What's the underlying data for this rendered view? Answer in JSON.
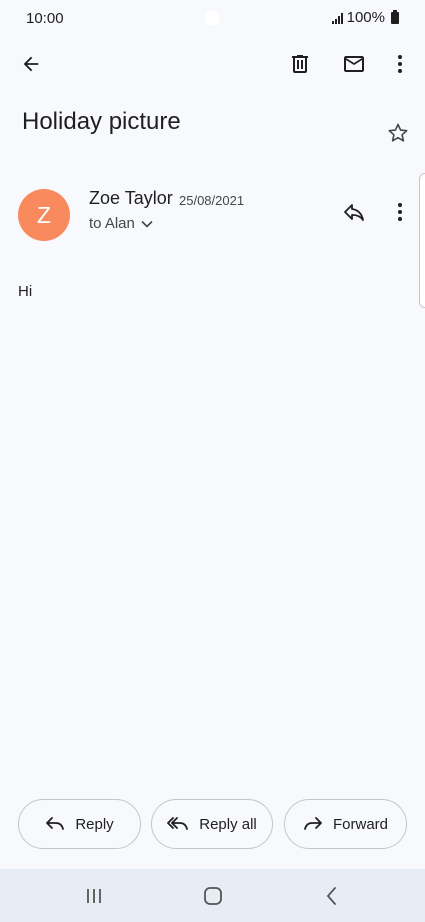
{
  "status_bar": {
    "time": "10:00",
    "battery": "100%"
  },
  "app_bar": {
    "back": "back-arrow-icon",
    "delete": "trash-icon",
    "mark_unread": "mail-icon",
    "more": "more-vert-icon"
  },
  "email": {
    "subject": "Holiday picture",
    "sender": {
      "initial": "Z",
      "name": "Zoe Taylor",
      "date": "25/08/2021",
      "recipient": "to Alan"
    },
    "body": "Hi"
  },
  "actions": {
    "reply": "Reply",
    "reply_all": "Reply all",
    "forward": "Forward"
  },
  "colors": {
    "avatar": "#f98a5e",
    "background": "#f8f9fc",
    "nav_bar": "#e6edf4"
  }
}
